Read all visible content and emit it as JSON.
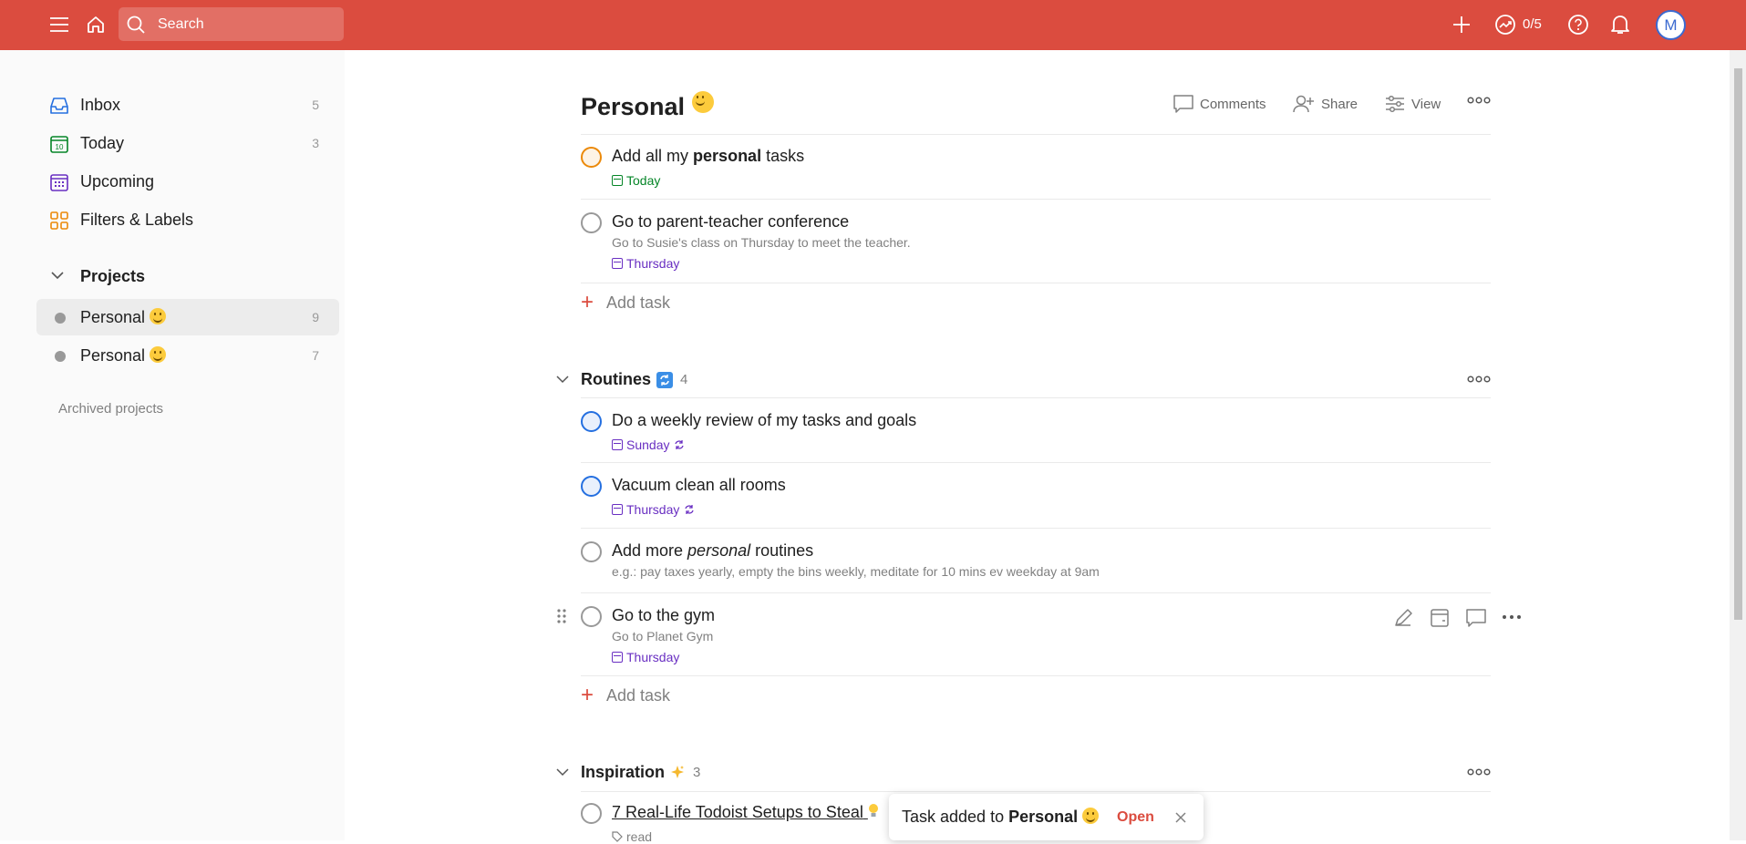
{
  "topbar": {
    "search_placeholder": "Search",
    "karma": "0/5",
    "avatar_initial": "M",
    "brand_color": "#db4c3f"
  },
  "sidebar": {
    "nav": [
      {
        "label": "Inbox",
        "count": "5",
        "icon": "inbox-icon"
      },
      {
        "label": "Today",
        "count": "3",
        "icon": "calendar-today-icon"
      },
      {
        "label": "Upcoming",
        "count": "",
        "icon": "calendar-grid-icon"
      },
      {
        "label": "Filters & Labels",
        "count": "",
        "icon": "filters-icon"
      }
    ],
    "projects_heading": "Projects",
    "projects": [
      {
        "label": "Personal",
        "count": "9",
        "active": true
      },
      {
        "label": "Personal",
        "count": "7",
        "active": false
      }
    ],
    "archived": "Archived projects"
  },
  "main": {
    "title": "Personal",
    "actions": {
      "comments": "Comments",
      "share": "Share",
      "view": "View"
    },
    "add_task_label": "Add task",
    "tasks_top": [
      {
        "title_parts": [
          "Add all my ",
          "personal",
          " tasks"
        ],
        "due": "Today",
        "check": "orange"
      },
      {
        "title": "Go to parent-teacher conference",
        "desc": "Go to Susie's class on Thursday to meet the teacher.",
        "due": "Thursday"
      }
    ],
    "sections": [
      {
        "name": "Routines",
        "count": "4",
        "tasks": [
          {
            "title": "Do a weekly review of my tasks and goals",
            "due": "Sunday",
            "recurring": true,
            "check": "blue"
          },
          {
            "title": "Vacuum clean all rooms",
            "due": "Thursday",
            "recurring": true,
            "check": "blue"
          },
          {
            "title_parts": [
              "Add more ",
              "personal",
              " routines"
            ],
            "desc": "e.g.: pay taxes yearly, empty the bins weekly, meditate for 10 mins ev weekday at 9am"
          },
          {
            "title": "Go to the gym",
            "desc": "Go to Planet Gym",
            "due": "Thursday"
          }
        ]
      },
      {
        "name": "Inspiration",
        "count": "3",
        "tasks": [
          {
            "title": "7 Real-Life Todoist Setups to Steal",
            "label": "read"
          }
        ]
      }
    ]
  },
  "toast": {
    "prefix": "Task added to ",
    "project": "Personal",
    "action": "Open"
  }
}
